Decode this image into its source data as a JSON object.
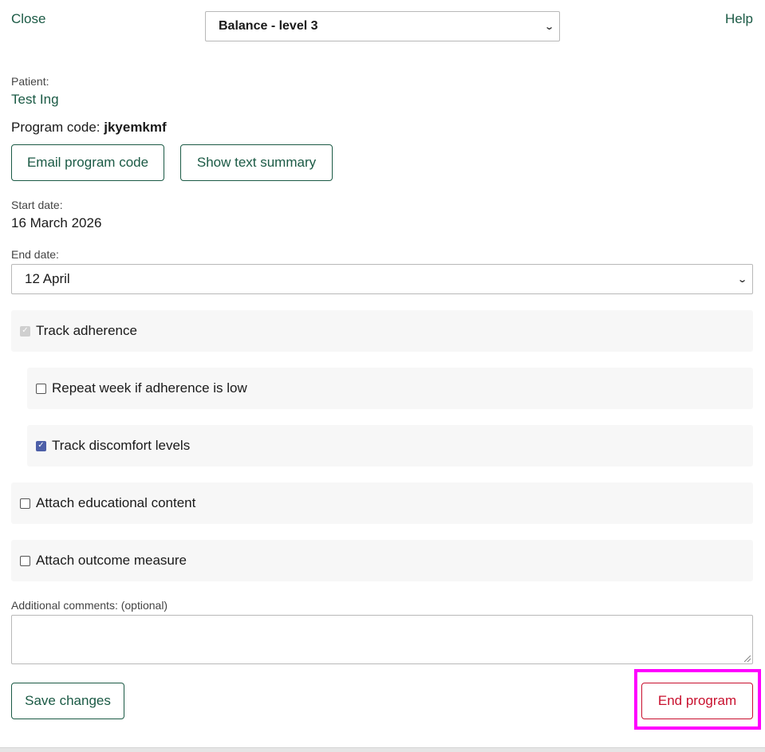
{
  "header": {
    "close_label": "Close",
    "help_label": "Help",
    "program_select_value": "Balance - level 3"
  },
  "patient": {
    "label": "Patient:",
    "name": "Test Ing"
  },
  "program_code": {
    "label": "Program code:",
    "value": "jkyemkmf"
  },
  "actions": {
    "email_label": "Email program code",
    "summary_label": "Show text summary"
  },
  "start_date": {
    "label": "Start date:",
    "value": "16 March 2026"
  },
  "end_date": {
    "label": "End date:",
    "value": "12 April"
  },
  "options": [
    {
      "label": "Track adherence",
      "checked": true,
      "disabled": true
    },
    {
      "label": "Repeat week if adherence is low",
      "checked": false,
      "disabled": false
    },
    {
      "label": "Track discomfort levels",
      "checked": true,
      "disabled": false
    },
    {
      "label": "Attach educational content",
      "checked": false,
      "disabled": false
    },
    {
      "label": "Attach outcome measure",
      "checked": false,
      "disabled": false
    }
  ],
  "comments": {
    "label": "Additional comments: (optional)",
    "value": ""
  },
  "footer": {
    "save_label": "Save changes",
    "end_label": "End program"
  },
  "colors": {
    "accent": "#1b5a45",
    "danger": "#c8102e",
    "checkbox": "#4d5fa8",
    "highlight": "#ff00ff"
  }
}
